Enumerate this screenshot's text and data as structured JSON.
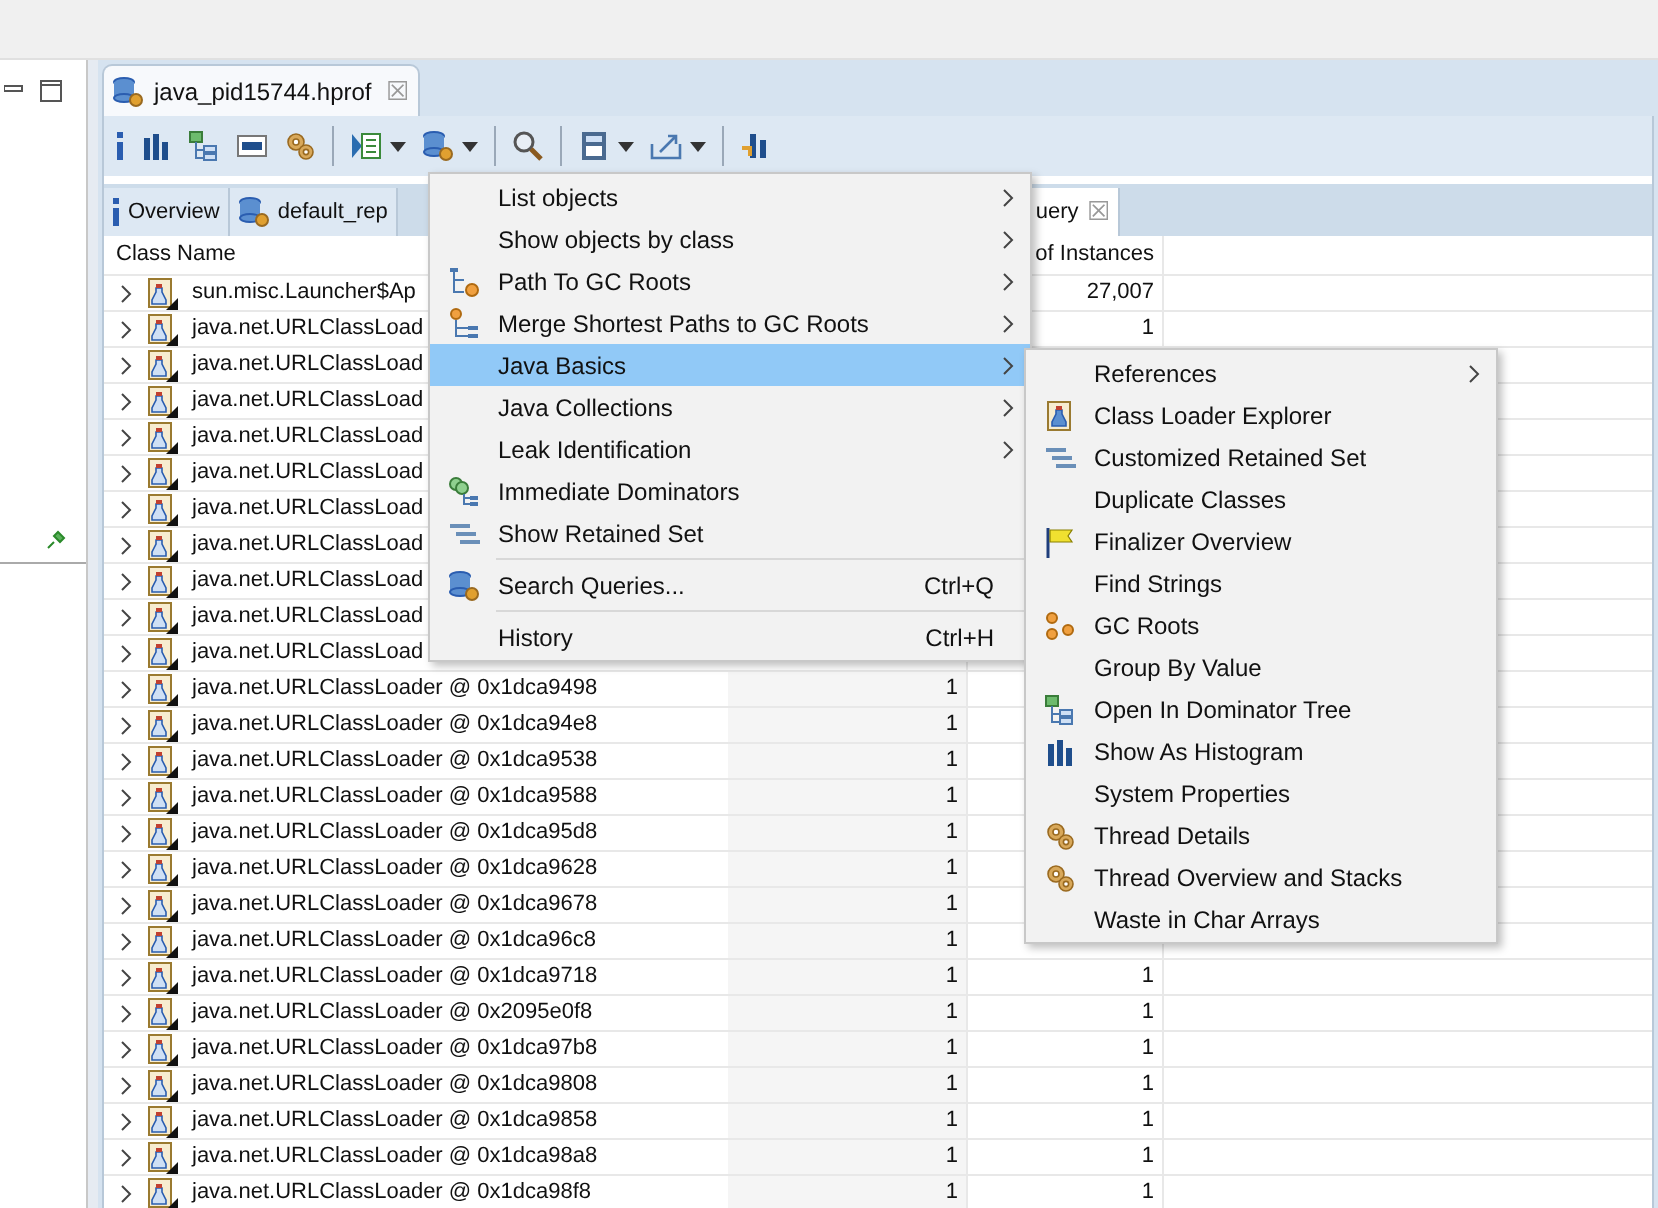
{
  "editor_tab": {
    "title": "java_pid15744.hprof",
    "close": "☒"
  },
  "toolbar": {
    "buttons": [
      {
        "kind": "info"
      },
      {
        "kind": "histogram"
      },
      {
        "kind": "tree"
      },
      {
        "kind": "oql"
      },
      {
        "kind": "gears"
      },
      {
        "kind": "separator"
      },
      {
        "kind": "report",
        "dropdown": true
      },
      {
        "kind": "query",
        "dropdown": true
      },
      {
        "kind": "separator"
      },
      {
        "kind": "search"
      },
      {
        "kind": "separator"
      },
      {
        "kind": "calculator",
        "dropdown": true
      },
      {
        "kind": "export",
        "dropdown": true
      },
      {
        "kind": "separator"
      },
      {
        "kind": "chart"
      }
    ]
  },
  "sub_tabs": [
    {
      "label": "Overview",
      "kind": "info",
      "selected": false
    },
    {
      "label": "default_rep",
      "kind": "query",
      "selected": false
    },
    {
      "label": "uery",
      "kind": "plain",
      "selected": true,
      "close": "☒"
    }
  ],
  "table": {
    "columns": {
      "class_name": "Class Name",
      "column_3": "of Instances"
    },
    "rows": [
      {
        "class_name": "sun.misc.Launcher$Ap",
        "column_3": "27,007"
      },
      {
        "class_name": "java.net.URLClassLoad",
        "column_3": "1"
      },
      {
        "class_name": "java.net.URLClassLoad"
      },
      {
        "class_name": "java.net.URLClassLoad"
      },
      {
        "class_name": "java.net.URLClassLoad"
      },
      {
        "class_name": "java.net.URLClassLoad"
      },
      {
        "class_name": "java.net.URLClassLoad"
      },
      {
        "class_name": "java.net.URLClassLoad"
      },
      {
        "class_name": "java.net.URLClassLoad"
      },
      {
        "class_name": "java.net.URLClassLoad"
      },
      {
        "class_name": "java.net.URLClassLoad"
      },
      {
        "class_name": "java.net.URLClassLoader @ 0x1dca9498",
        "column_2": "1"
      },
      {
        "class_name": "java.net.URLClassLoader @ 0x1dca94e8",
        "column_2": "1"
      },
      {
        "class_name": "java.net.URLClassLoader @ 0x1dca9538",
        "column_2": "1"
      },
      {
        "class_name": "java.net.URLClassLoader @ 0x1dca9588",
        "column_2": "1"
      },
      {
        "class_name": "java.net.URLClassLoader @ 0x1dca95d8",
        "column_2": "1"
      },
      {
        "class_name": "java.net.URLClassLoader @ 0x1dca9628",
        "column_2": "1"
      },
      {
        "class_name": "java.net.URLClassLoader @ 0x1dca9678",
        "column_2": "1"
      },
      {
        "class_name": "java.net.URLClassLoader @ 0x1dca96c8",
        "column_2": "1"
      },
      {
        "class_name": "java.net.URLClassLoader @ 0x1dca9718",
        "column_2": "1",
        "column_3": "1"
      },
      {
        "class_name": "java.net.URLClassLoader @ 0x2095e0f8",
        "column_2": "1",
        "column_3": "1"
      },
      {
        "class_name": "java.net.URLClassLoader @ 0x1dca97b8",
        "column_2": "1",
        "column_3": "1"
      },
      {
        "class_name": "java.net.URLClassLoader @ 0x1dca9808",
        "column_2": "1",
        "column_3": "1"
      },
      {
        "class_name": "java.net.URLClassLoader @ 0x1dca9858",
        "column_2": "1",
        "column_3": "1"
      },
      {
        "class_name": "java.net.URLClassLoader @ 0x1dca98a8",
        "column_2": "1",
        "column_3": "1"
      },
      {
        "class_name": "java.net.URLClassLoader @ 0x1dca98f8",
        "column_2": "1",
        "column_3": "1"
      }
    ]
  },
  "context_menu": {
    "items": [
      {
        "label": "List objects",
        "kind": "none",
        "submenu": true,
        "selected": false
      },
      {
        "label": "Show objects by class",
        "kind": "none",
        "submenu": true,
        "selected": false
      },
      {
        "label": "Path To GC Roots",
        "kind": "path",
        "submenu": true,
        "selected": false
      },
      {
        "label": "Merge Shortest Paths to GC Roots",
        "kind": "merge",
        "submenu": true,
        "selected": false
      },
      {
        "label": "Java Basics",
        "kind": "none",
        "submenu": true,
        "selected": true
      },
      {
        "label": "Java Collections",
        "kind": "none",
        "submenu": true,
        "selected": false
      },
      {
        "label": "Leak Identification",
        "kind": "none",
        "submenu": true,
        "selected": false
      },
      {
        "label": "Immediate Dominators",
        "kind": "dominators",
        "submenu": false,
        "selected": false
      },
      {
        "label": "Show Retained Set",
        "kind": "retained",
        "submenu": false,
        "selected": false
      },
      {
        "label": "Search Queries...",
        "kind": "query",
        "submenu": false,
        "selected": false,
        "shortcut": "Ctrl+Q",
        "separator_before": true
      },
      {
        "label": "History",
        "kind": "none",
        "submenu": false,
        "selected": false,
        "shortcut": "Ctrl+H",
        "separator_before": true
      }
    ]
  },
  "submenu": {
    "items": [
      {
        "label": "References",
        "kind": "none",
        "submenu": true
      },
      {
        "label": "Class Loader Explorer",
        "kind": "classloader",
        "submenu": false
      },
      {
        "label": "Customized Retained Set",
        "kind": "retained",
        "submenu": false
      },
      {
        "label": "Duplicate Classes",
        "kind": "none",
        "submenu": false
      },
      {
        "label": "Finalizer Overview",
        "kind": "flag",
        "submenu": false
      },
      {
        "label": "Find Strings",
        "kind": "none",
        "submenu": false
      },
      {
        "label": "GC Roots",
        "kind": "roots",
        "submenu": false
      },
      {
        "label": "Group By Value",
        "kind": "none",
        "submenu": false
      },
      {
        "label": "Open In Dominator Tree",
        "kind": "tree",
        "submenu": false
      },
      {
        "label": "Show As Histogram",
        "kind": "histogram",
        "submenu": false
      },
      {
        "label": "System Properties",
        "kind": "none",
        "submenu": false
      },
      {
        "label": "Thread Details",
        "kind": "gears",
        "submenu": false
      },
      {
        "label": "Thread Overview and Stacks",
        "kind": "gears",
        "submenu": false
      },
      {
        "label": "Waste in Char Arrays",
        "kind": "none",
        "submenu": false
      }
    ]
  }
}
